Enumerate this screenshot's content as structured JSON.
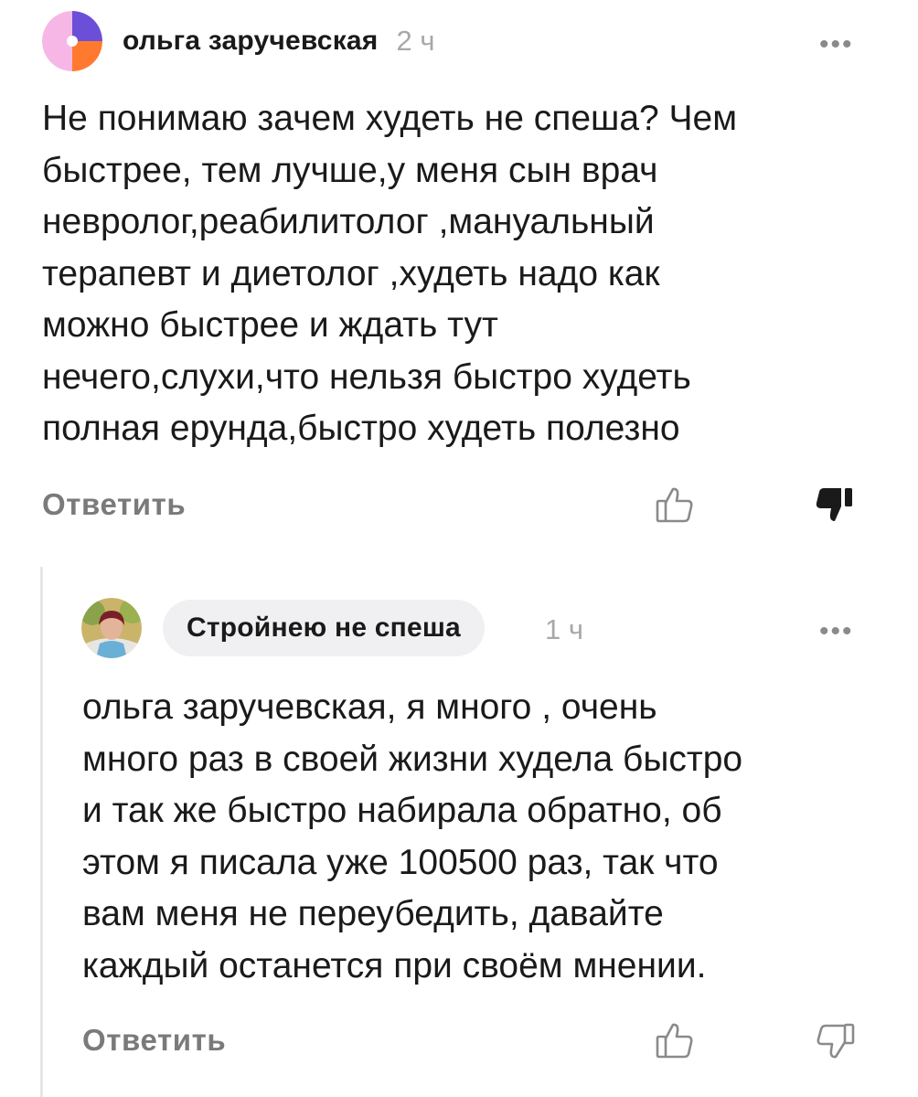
{
  "comment": {
    "author": "ольга заручевская",
    "time": "2 ч",
    "text_lines": [
      "Не понимаю зачем худеть не спеша? Чем",
      "быстрее, тем лучше,у меня сын врач",
      "невролог,реабилитолог ,мануальный",
      "терапевт и диетолог ,худеть надо как",
      "можно быстрее и ждать тут",
      "нечего,слухи,что нельзя быстро худеть",
      "полная ерунда,быстро худеть полезно"
    ],
    "reply_label": "Ответить",
    "more_label": "•••",
    "disliked": true
  },
  "reply": {
    "author": "Стройнею не спеша",
    "time": "1 ч",
    "text_lines": [
      "ольга заручевская, я много , очень",
      "много раз в своей жизни худела быстро",
      "и так же быстро набирала обратно, об",
      "этом я писала уже 100500 раз, так что",
      "вам меня не переубедить, давайте",
      "каждый останется при своём мнении."
    ],
    "reply_label": "Ответить",
    "more_label": "•••",
    "disliked": false
  },
  "icons": {
    "like": "thumbs-up-outline-icon",
    "dislike_filled": "thumbs-down-filled-icon",
    "dislike_outline": "thumbs-down-outline-icon",
    "more": "more-dots-icon"
  },
  "colors": {
    "text": "#1a1a1a",
    "muted": "#a8a8a8",
    "action": "#7a7a7a",
    "pill_bg": "#f0f0f2",
    "thread_line": "#e6e6e6"
  }
}
